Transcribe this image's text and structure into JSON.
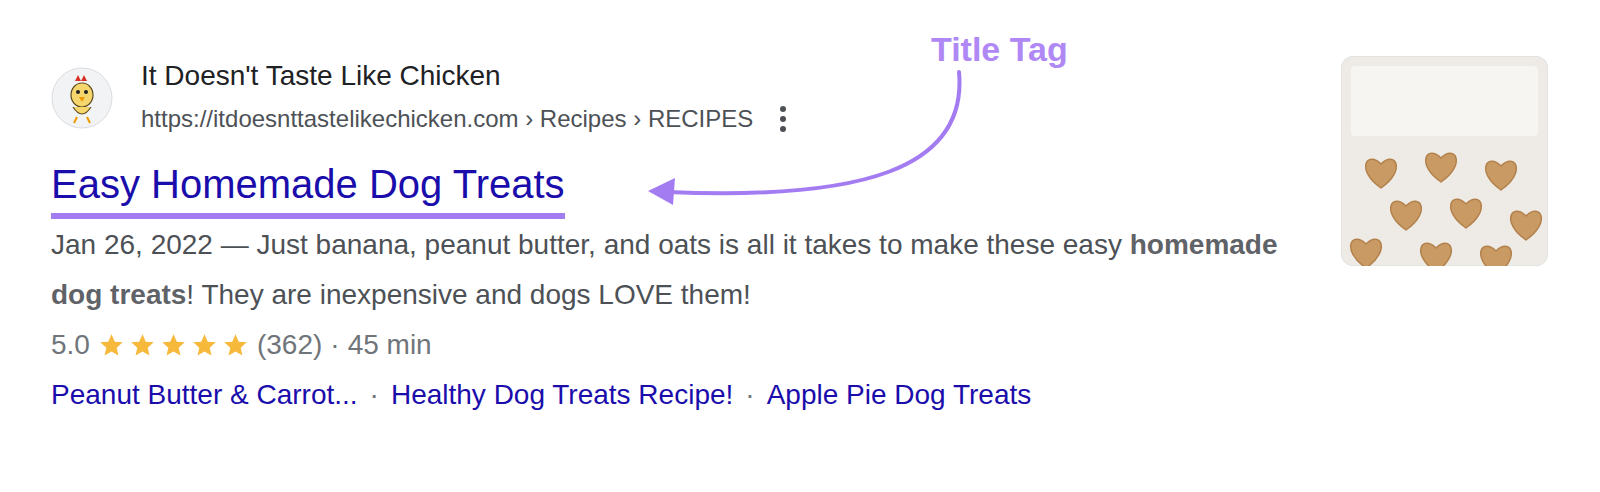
{
  "annotation": {
    "label": "Title Tag"
  },
  "result": {
    "site_name": "It Doesn't Taste Like Chicken",
    "url": "https://itdoesnttastelikechicken.com › Recipes › RECIPES",
    "title": "Easy Homemade Dog Treats",
    "date": "Jan 26, 2022",
    "date_separator": "—",
    "snippet": [
      {
        "text": "Just banana, peanut butter, and oats is all it takes to make these easy ",
        "bold": false
      },
      {
        "text": "homemade dog treats",
        "bold": true
      },
      {
        "text": "! They are inexpensive and dogs LOVE them!",
        "bold": false
      }
    ],
    "rating": {
      "score": "5.0",
      "stars": 5,
      "count": "(362)",
      "separator": "·",
      "time": "45 min"
    },
    "sitelinks": [
      {
        "label": "Peanut Butter & Carrot..."
      },
      {
        "label": "Healthy Dog Treats Recipe!"
      },
      {
        "label": "Apple Pie Dog Treats"
      }
    ],
    "sitelink_separator": "·"
  }
}
